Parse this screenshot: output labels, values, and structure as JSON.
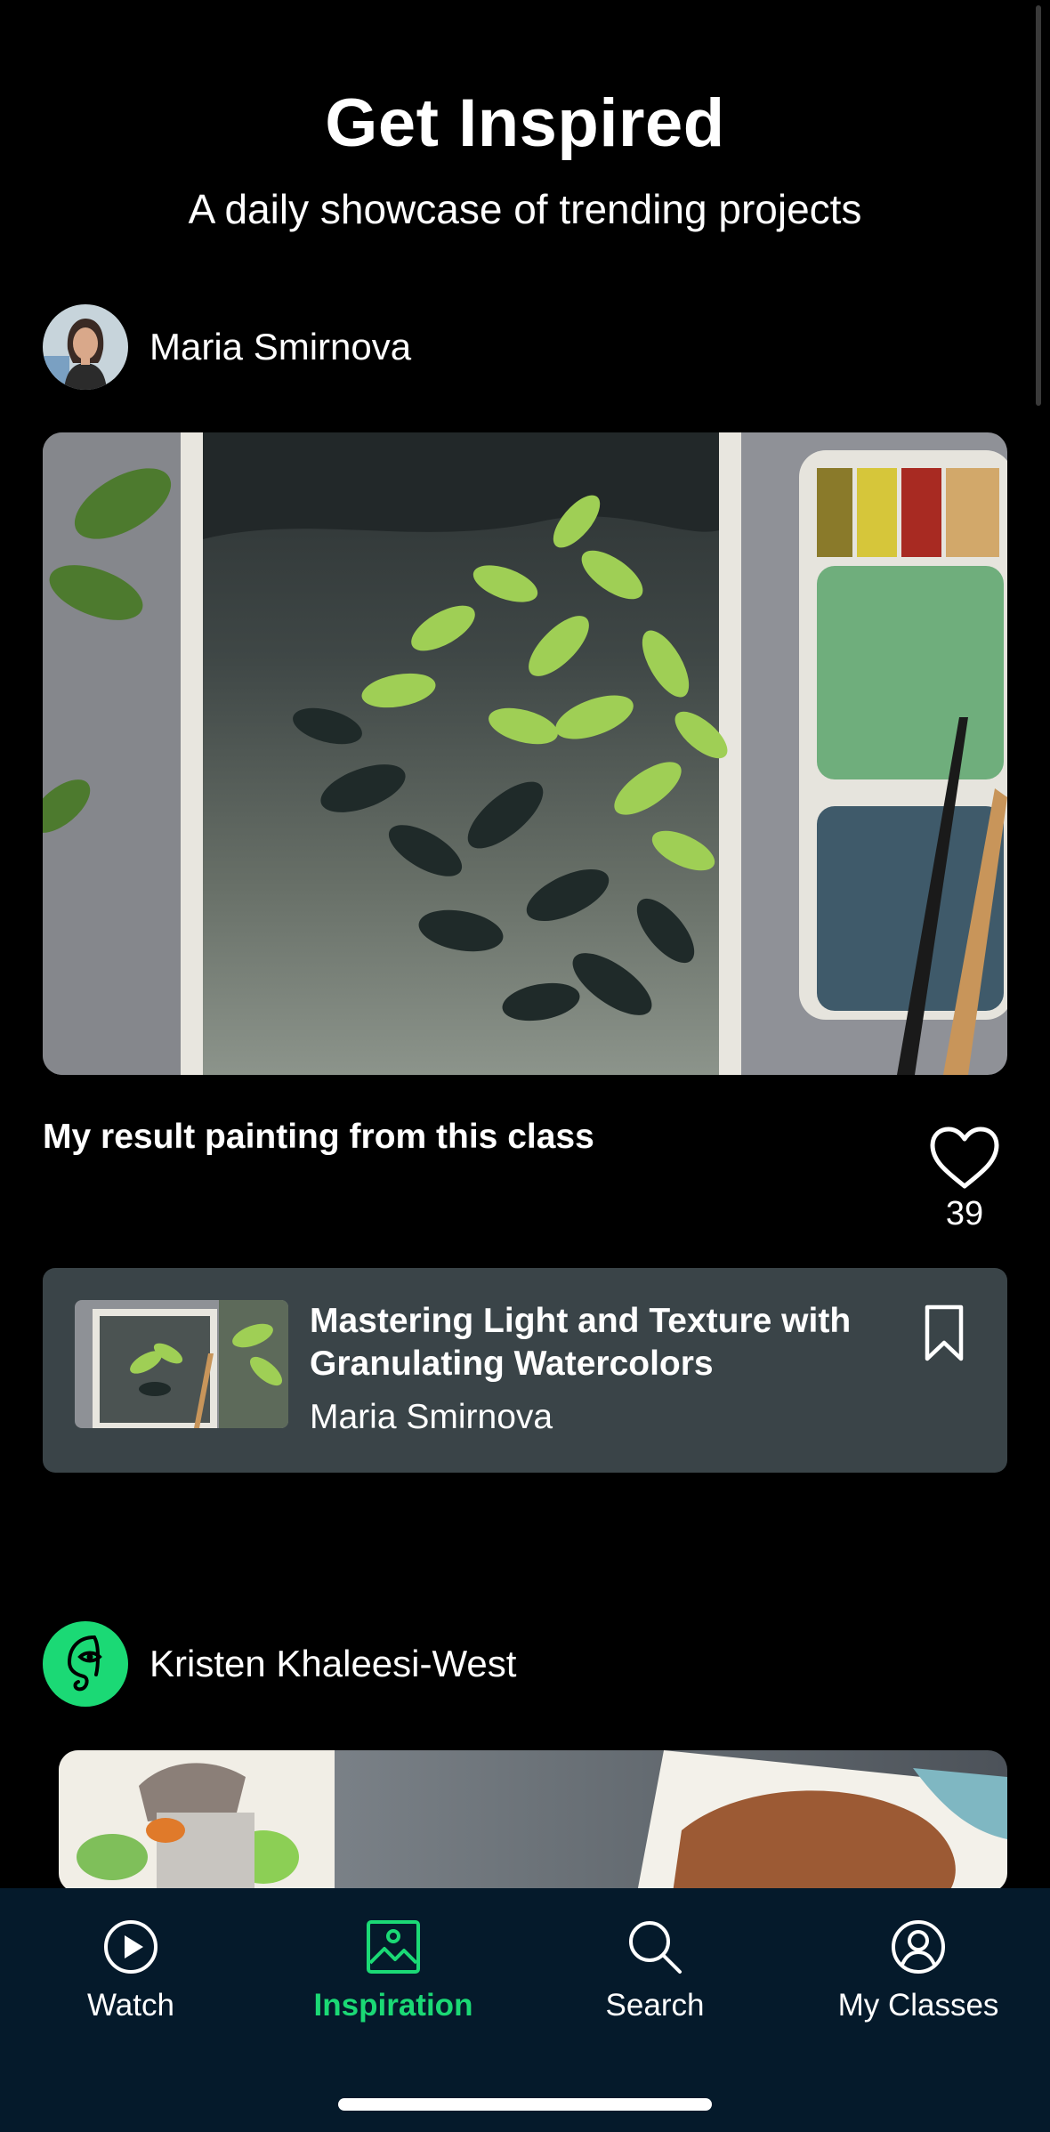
{
  "header": {
    "title": "Get Inspired",
    "subtitle": "A daily showcase of trending projects"
  },
  "posts": [
    {
      "author": "Maria Smirnova",
      "caption": "My result painting from this class",
      "likes": "39",
      "class_card": {
        "title": "Mastering Light and Texture with Granulating Watercolors",
        "author": "Maria Smirnova"
      }
    },
    {
      "author": "Kristen Khaleesi-West"
    }
  ],
  "nav": {
    "items": [
      {
        "label": "Watch",
        "icon": "play-circle-icon"
      },
      {
        "label": "Inspiration",
        "icon": "image-icon"
      },
      {
        "label": "Search",
        "icon": "search-icon"
      },
      {
        "label": "My Classes",
        "icon": "user-circle-icon"
      }
    ],
    "active": "Inspiration"
  },
  "colors": {
    "background": "#000000",
    "card": "#3a4448",
    "nav_background": "#051a2b",
    "accent": "#1bd975"
  }
}
